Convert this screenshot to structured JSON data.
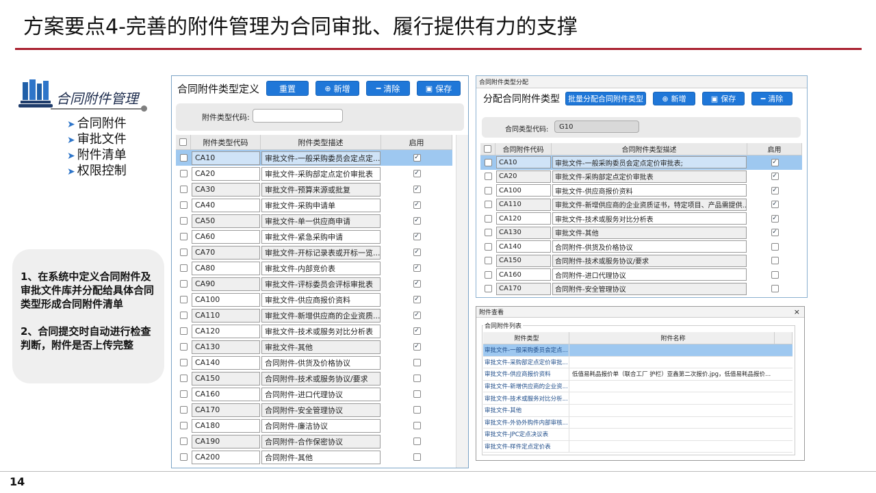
{
  "slide": {
    "title": "方案要点4-完善的附件管理为合同审批、履行提供有力的支撑",
    "page_number": "14"
  },
  "nav": {
    "title": "合同附件管理",
    "items": [
      "合同附件",
      "审批文件",
      "附件清单",
      "权限控制"
    ]
  },
  "notes": [
    "1、在系统中定义合同附件及审批文件库并分配给具体合同类型形成合同附件清单",
    "2、合同提交时自动进行检查判断，附件是否上传完整"
  ],
  "panel1": {
    "title": "合同附件类型定义",
    "buttons": {
      "reset": "重置",
      "add": "新增",
      "clear": "清除",
      "save": "保存"
    },
    "search_label": "附件类型代码:",
    "search_value": "",
    "columns": [
      "附件类型代码",
      "附件类型描述",
      "启用"
    ],
    "rows": [
      {
        "code": "CA10",
        "desc": "审批文件-一般采购委员会定点定...",
        "enabled": true
      },
      {
        "code": "CA20",
        "desc": "审批文件-采购部定点定价审批表",
        "enabled": true
      },
      {
        "code": "CA30",
        "desc": "审批文件-预算来源或批复",
        "enabled": true
      },
      {
        "code": "CA40",
        "desc": "审批文件-采购申请单",
        "enabled": true
      },
      {
        "code": "CA50",
        "desc": "审批文件-单一供应商申请",
        "enabled": true
      },
      {
        "code": "CA60",
        "desc": "审批文件-紧急采购申请",
        "enabled": true
      },
      {
        "code": "CA70",
        "desc": "审批文件-开标记录表或开标一览...",
        "enabled": true
      },
      {
        "code": "CA80",
        "desc": "审批文件-内部竞价表",
        "enabled": true
      },
      {
        "code": "CA90",
        "desc": "审批文件-评标委员会评标审批表",
        "enabled": true
      },
      {
        "code": "CA100",
        "desc": "审批文件-供应商报价资料",
        "enabled": true
      },
      {
        "code": "CA110",
        "desc": "审批文件-新增供应商的企业资质...",
        "enabled": true
      },
      {
        "code": "CA120",
        "desc": "审批文件-技术或服务对比分析表",
        "enabled": true
      },
      {
        "code": "CA130",
        "desc": "审批文件-其他",
        "enabled": true
      },
      {
        "code": "CA140",
        "desc": "合同附件-供货及价格协议",
        "enabled": false
      },
      {
        "code": "CA150",
        "desc": "合同附件-技术或服务协议/要求",
        "enabled": false
      },
      {
        "code": "CA160",
        "desc": "合同附件-进口代理协议",
        "enabled": false
      },
      {
        "code": "CA170",
        "desc": "合同附件-安全管理协议",
        "enabled": false
      },
      {
        "code": "CA180",
        "desc": "合同附件-廉洁协议",
        "enabled": false
      },
      {
        "code": "CA190",
        "desc": "合同附件-合作保密协议",
        "enabled": false
      },
      {
        "code": "CA200",
        "desc": "合同附件-其他",
        "enabled": false
      }
    ]
  },
  "panel2": {
    "caption": "合同附件类型分配",
    "title": "分配合同附件类型",
    "buttons": {
      "batch": "批量分配合同附件类型",
      "add": "新增",
      "save": "保存",
      "clear": "清除"
    },
    "search_label": "合同类型代码:",
    "search_value": "G10",
    "columns": [
      "合同附件代码",
      "合同附件类型描述",
      "启用"
    ],
    "rows": [
      {
        "code": "CA10",
        "desc": "审批文件-一般采购委员会定点定价审批表;",
        "enabled": true
      },
      {
        "code": "CA20",
        "desc": "审批文件-采购部定点定价审批表",
        "enabled": true
      },
      {
        "code": "CA100",
        "desc": "审批文件-供应商报价资料",
        "enabled": true
      },
      {
        "code": "CA110",
        "desc": "审批文件-新增供应商的企业资质证书，特定项目、产品需提供...",
        "enabled": true
      },
      {
        "code": "CA120",
        "desc": "审批文件-技术或服务对比分析表",
        "enabled": true
      },
      {
        "code": "CA130",
        "desc": "审批文件-其他",
        "enabled": true
      },
      {
        "code": "CA140",
        "desc": "合同附件-供货及价格协议",
        "enabled": false
      },
      {
        "code": "CA150",
        "desc": "合同附件-技术或服务协议/要求",
        "enabled": false
      },
      {
        "code": "CA160",
        "desc": "合同附件-进口代理协议",
        "enabled": false
      },
      {
        "code": "CA170",
        "desc": "合同附件-安全管理协议",
        "enabled": false
      }
    ]
  },
  "panel3": {
    "caption": "附件查看",
    "close": "×",
    "legend": "合同附件列表",
    "columns": [
      "附件类型",
      "附件名称"
    ],
    "rows": [
      {
        "type": "审批文件-一般采购委员会定点...",
        "name": ""
      },
      {
        "type": "审批文件-采购部定点定价审批...",
        "name": ""
      },
      {
        "type": "审批文件-供应商报价资料",
        "name": "低值易耗品报价单（联合工厂 护栏）亚鑫第二次报价.jpg，低值易耗品报价..."
      },
      {
        "type": "审批文件-新增供应商的企业资...",
        "name": ""
      },
      {
        "type": "审批文件-技术或服务对比分析...",
        "name": ""
      },
      {
        "type": "审批文件-其他",
        "name": ""
      },
      {
        "type": "审批文件-外协外购件内部审核...",
        "name": ""
      },
      {
        "type": "审批文件-JPC定点决议表",
        "name": ""
      },
      {
        "type": "审批文件-样件定点定价表",
        "name": ""
      }
    ]
  },
  "colors": {
    "accent_red": "#a81d2c",
    "button_blue": "#1f77d8",
    "selected_row": "#9ec8f0"
  },
  "icons": [
    "laptop-files-icon",
    "arrow-right-icon",
    "plus-circle-icon",
    "minus-icon",
    "save-disk-icon",
    "close-icon",
    "checkbox-icon"
  ]
}
